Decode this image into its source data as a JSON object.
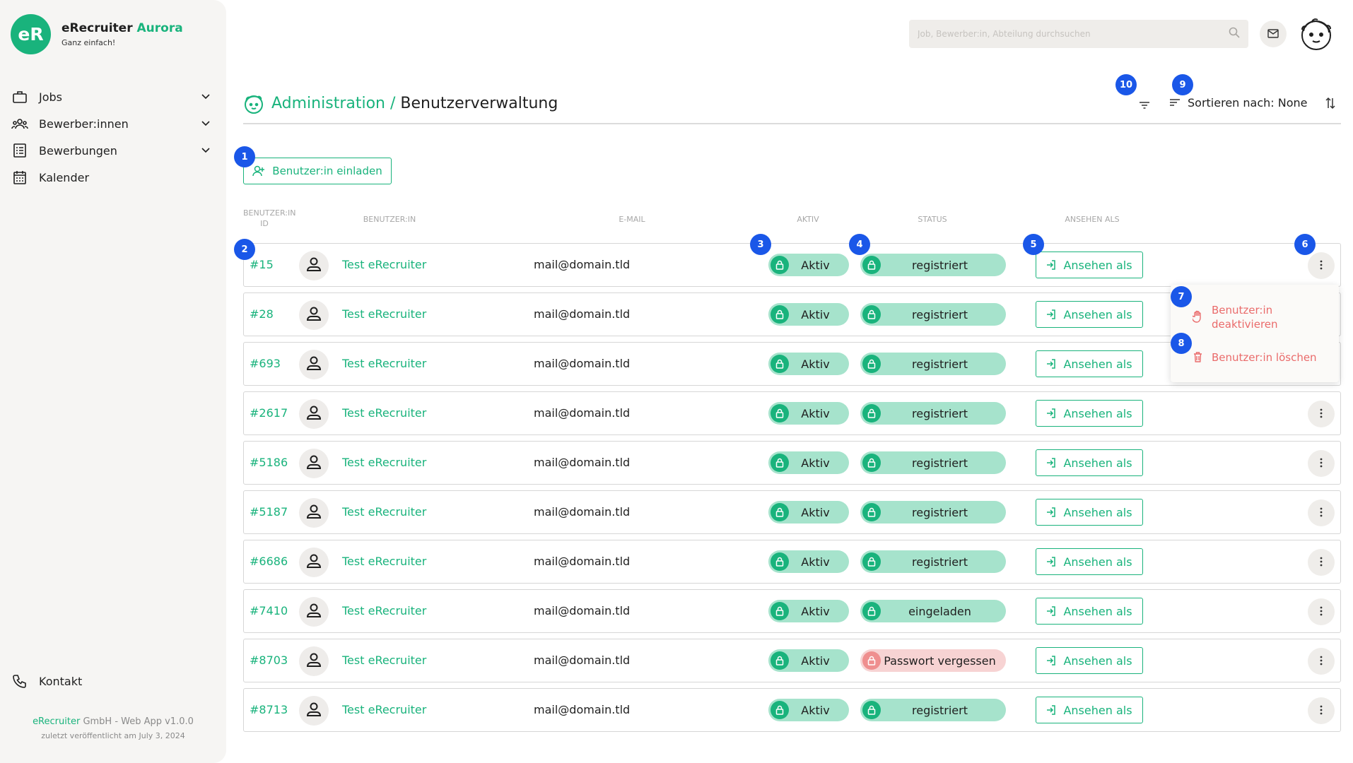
{
  "brand": {
    "logo_text": "eR",
    "name": "eRecruiter",
    "name_accent": "Aurora",
    "tagline": "Ganz einfach!",
    "accent_color": "#19b37c"
  },
  "nav": [
    {
      "label": "Jobs",
      "icon": "briefcase-icon"
    },
    {
      "label": "Bewerber:innen",
      "icon": "users-icon"
    },
    {
      "label": "Bewerbungen",
      "icon": "list-icon"
    },
    {
      "label": "Kalender",
      "icon": "calendar-icon"
    }
  ],
  "contact_label": "Kontakt",
  "footer": {
    "brand": "eRecruiter",
    "line1": "GmbH - Web App v1.0.0",
    "line2": "zuletzt veröffentlicht am July 3, 2024"
  },
  "search": {
    "placeholder": "Job, Bewerber:in, Abteilung durchsuchen"
  },
  "page": {
    "crumb_link": "Administration",
    "separator": " / ",
    "crumb_current": "Benutzerverwaltung",
    "sort_label": "Sortieren nach: None"
  },
  "invite_label": "Benutzer:in einladen",
  "badges": [
    "1",
    "2",
    "3",
    "4",
    "5",
    "6",
    "7",
    "8",
    "9",
    "10"
  ],
  "columns": {
    "id_line1": "Benutzer:in",
    "id_line2": "ID",
    "user": "Benutzer:in",
    "email": "E-Mail",
    "active": "Aktiv",
    "status": "Status",
    "view_as": "Ansehen als"
  },
  "rows": [
    {
      "id": "#15",
      "name": "Test eRecruiter",
      "email": "mail@domain.tld",
      "active": "Aktiv",
      "status": "registriert",
      "status_type": "ok",
      "view": "Ansehen als"
    },
    {
      "id": "#28",
      "name": "Test eRecruiter",
      "email": "mail@domain.tld",
      "active": "Aktiv",
      "status": "registriert",
      "status_type": "ok",
      "view": "Ansehen als"
    },
    {
      "id": "#693",
      "name": "Test eRecruiter",
      "email": "mail@domain.tld",
      "active": "Aktiv",
      "status": "registriert",
      "status_type": "ok",
      "view": "Ansehen als"
    },
    {
      "id": "#2617",
      "name": "Test eRecruiter",
      "email": "mail@domain.tld",
      "active": "Aktiv",
      "status": "registriert",
      "status_type": "ok",
      "view": "Ansehen als"
    },
    {
      "id": "#5186",
      "name": "Test eRecruiter",
      "email": "mail@domain.tld",
      "active": "Aktiv",
      "status": "registriert",
      "status_type": "ok",
      "view": "Ansehen als"
    },
    {
      "id": "#5187",
      "name": "Test eRecruiter",
      "email": "mail@domain.tld",
      "active": "Aktiv",
      "status": "registriert",
      "status_type": "ok",
      "view": "Ansehen als"
    },
    {
      "id": "#6686",
      "name": "Test eRecruiter",
      "email": "mail@domain.tld",
      "active": "Aktiv",
      "status": "registriert",
      "status_type": "ok",
      "view": "Ansehen als"
    },
    {
      "id": "#7410",
      "name": "Test eRecruiter",
      "email": "mail@domain.tld",
      "active": "Aktiv",
      "status": "eingeladen",
      "status_type": "ok",
      "view": "Ansehen als"
    },
    {
      "id": "#8703",
      "name": "Test eRecruiter",
      "email": "mail@domain.tld",
      "active": "Aktiv",
      "status": "Passwort vergessen",
      "status_type": "danger",
      "view": "Ansehen als"
    },
    {
      "id": "#8713",
      "name": "Test eRecruiter",
      "email": "mail@domain.tld",
      "active": "Aktiv",
      "status": "registriert",
      "status_type": "ok",
      "view": "Ansehen als"
    }
  ],
  "menu": {
    "deactivate_line1": "Benutzer:in",
    "deactivate_line2": "deaktivieren",
    "delete": "Benutzer:in löschen"
  },
  "colors": {
    "accent": "#19b37c",
    "badge": "#1a57e8",
    "danger": "#ea6b6b"
  }
}
